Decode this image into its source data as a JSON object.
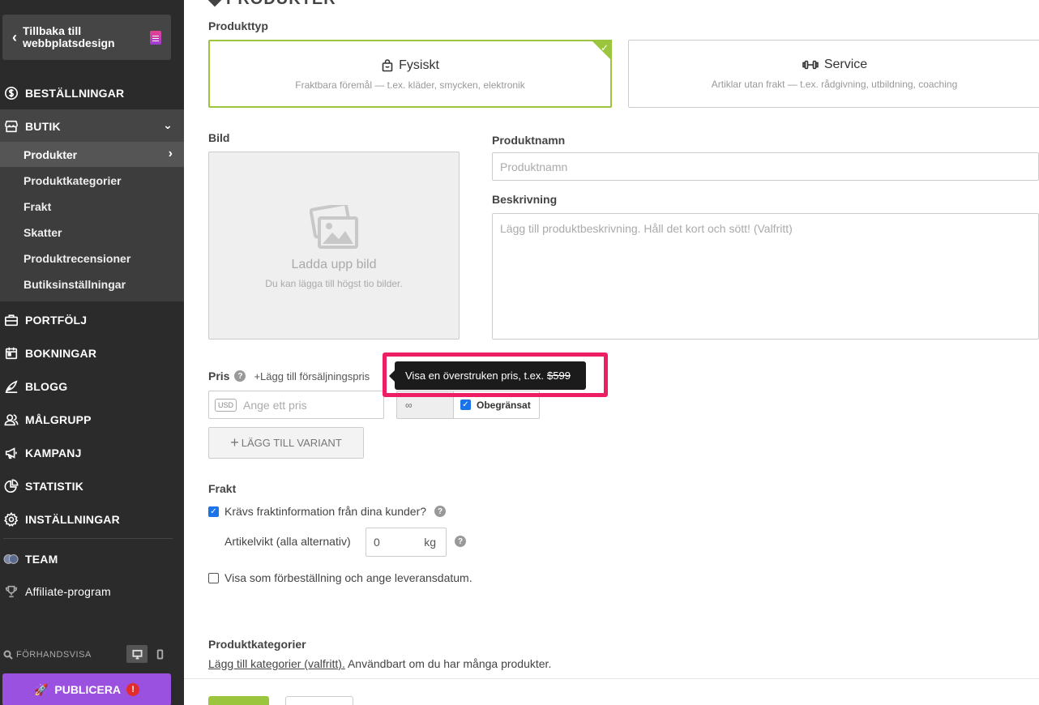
{
  "sidebar": {
    "back_label": "Tillbaka till webbplatsdesign",
    "nav": {
      "orders": "BESTÄLLNINGAR",
      "shop": "BUTIK",
      "portfolio": "PORTFÖLJ",
      "bookings": "BOKNINGAR",
      "blog": "BLOGG",
      "audience": "MÅLGRUPP",
      "campaign": "KAMPANJ",
      "statistics": "STATISTIK",
      "settings": "INSTÄLLNINGAR",
      "team": "TEAM",
      "affiliate": "Affiliate-program"
    },
    "shop_sub": {
      "products": "Produkter",
      "categories": "Produktkategorier",
      "shipping": "Frakt",
      "taxes": "Skatter",
      "reviews": "Produktrecensioner",
      "shop_settings": "Butiksinställningar"
    },
    "preview_label": "FÖRHANDSVISA",
    "publish_label": "PUBLICERA",
    "publish_badge": "!"
  },
  "main": {
    "heading": "PRODUKTER",
    "product_type_label": "Produkttyp",
    "type_physical": {
      "title": "Fysiskt",
      "desc": "Fraktbara föremål — t.ex. kläder, smycken, elektronik"
    },
    "type_service": {
      "title": "Service",
      "desc": "Artiklar utan frakt — t.ex. rådgivning, utbildning, coaching"
    },
    "image_label": "Bild",
    "upload_title": "Ladda upp bild",
    "upload_sub": "Du kan lägga till högst tio bilder.",
    "name_label": "Produktnamn",
    "name_placeholder": "Produktnamn",
    "desc_label": "Beskrivning",
    "desc_placeholder": "Lägg till produktbeskrivning. Håll det kort och sött! (Valfritt)",
    "price_label": "Pris",
    "add_sale_price": "+Lägg till försäljningspris",
    "currency": "USD",
    "price_placeholder": "Ange ett pris",
    "stock_value": "∞",
    "unlimited_label": "Obegränsat",
    "add_variant": "LÄGG TILL VARIANT",
    "shipping_label": "Frakt",
    "shipping_required": "Krävs fraktinformation från dina kunder?",
    "weight_label": "Artikelvikt (alla alternativ)",
    "weight_value": "0",
    "weight_unit": "kg",
    "preorder_label": "Visa som förbeställning och ange leveransdatum.",
    "categories_label": "Produktkategorier",
    "categories_link": "Lägg till kategorier (valfritt).",
    "categories_hint": " Användbart om du har många produkter.",
    "tooltip_text": "Visa en överstruken pris, t.ex.",
    "tooltip_strike": "$599"
  },
  "colors": {
    "sidebar_bg": "#2b2b2b",
    "accent_green": "#9bc53d",
    "publish_purple": "#9b51e0",
    "highlight_pink": "#ee1e64"
  }
}
